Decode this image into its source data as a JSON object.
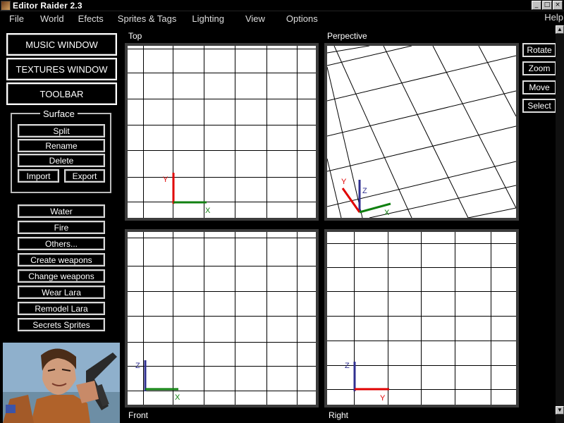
{
  "window": {
    "title": "Editor Raider 2.3"
  },
  "menu": {
    "items": [
      "File",
      "World",
      "Efects",
      "Sprites & Tags",
      "Lighting",
      "View",
      "Options"
    ],
    "help": "Help"
  },
  "left_panel": {
    "music_window": "MUSIC WINDOW",
    "textures_window": "TEXTURES WINDOW",
    "toolbar": "TOOLBAR",
    "surface": {
      "label": "Surface",
      "split": "Split",
      "rename": "Rename",
      "delete": "Delete",
      "import": "Import",
      "export": "Export"
    },
    "buttons": {
      "water": "Water",
      "fire": "Fire",
      "others": "Others...",
      "create_weapons": "Create  weapons",
      "change_weapons": "Change  weapons",
      "wear_lara": "Wear Lara",
      "remodel_lara": "Remodel Lara",
      "secrets_sprites": "Secrets Sprites"
    }
  },
  "viewports": {
    "top": {
      "label": "Top",
      "axis1": "Y",
      "axis2": "X"
    },
    "perspective": {
      "label": "Perpective",
      "axis_y": "Y",
      "axis_z": "Z",
      "axis_x": "X"
    },
    "front": {
      "label": "Front",
      "axis1": "Z",
      "axis2": "X"
    },
    "right": {
      "label": "Right",
      "axis1": "Z",
      "axis2": "Y"
    }
  },
  "nav": {
    "rotate": "Rotate",
    "zoom": "Zoom",
    "move": "Move",
    "select": "Select"
  },
  "colors": {
    "axis_red": "#e00000",
    "axis_green": "#108010",
    "axis_blue": "#303090",
    "viewport_border": "#3c3c3c"
  }
}
